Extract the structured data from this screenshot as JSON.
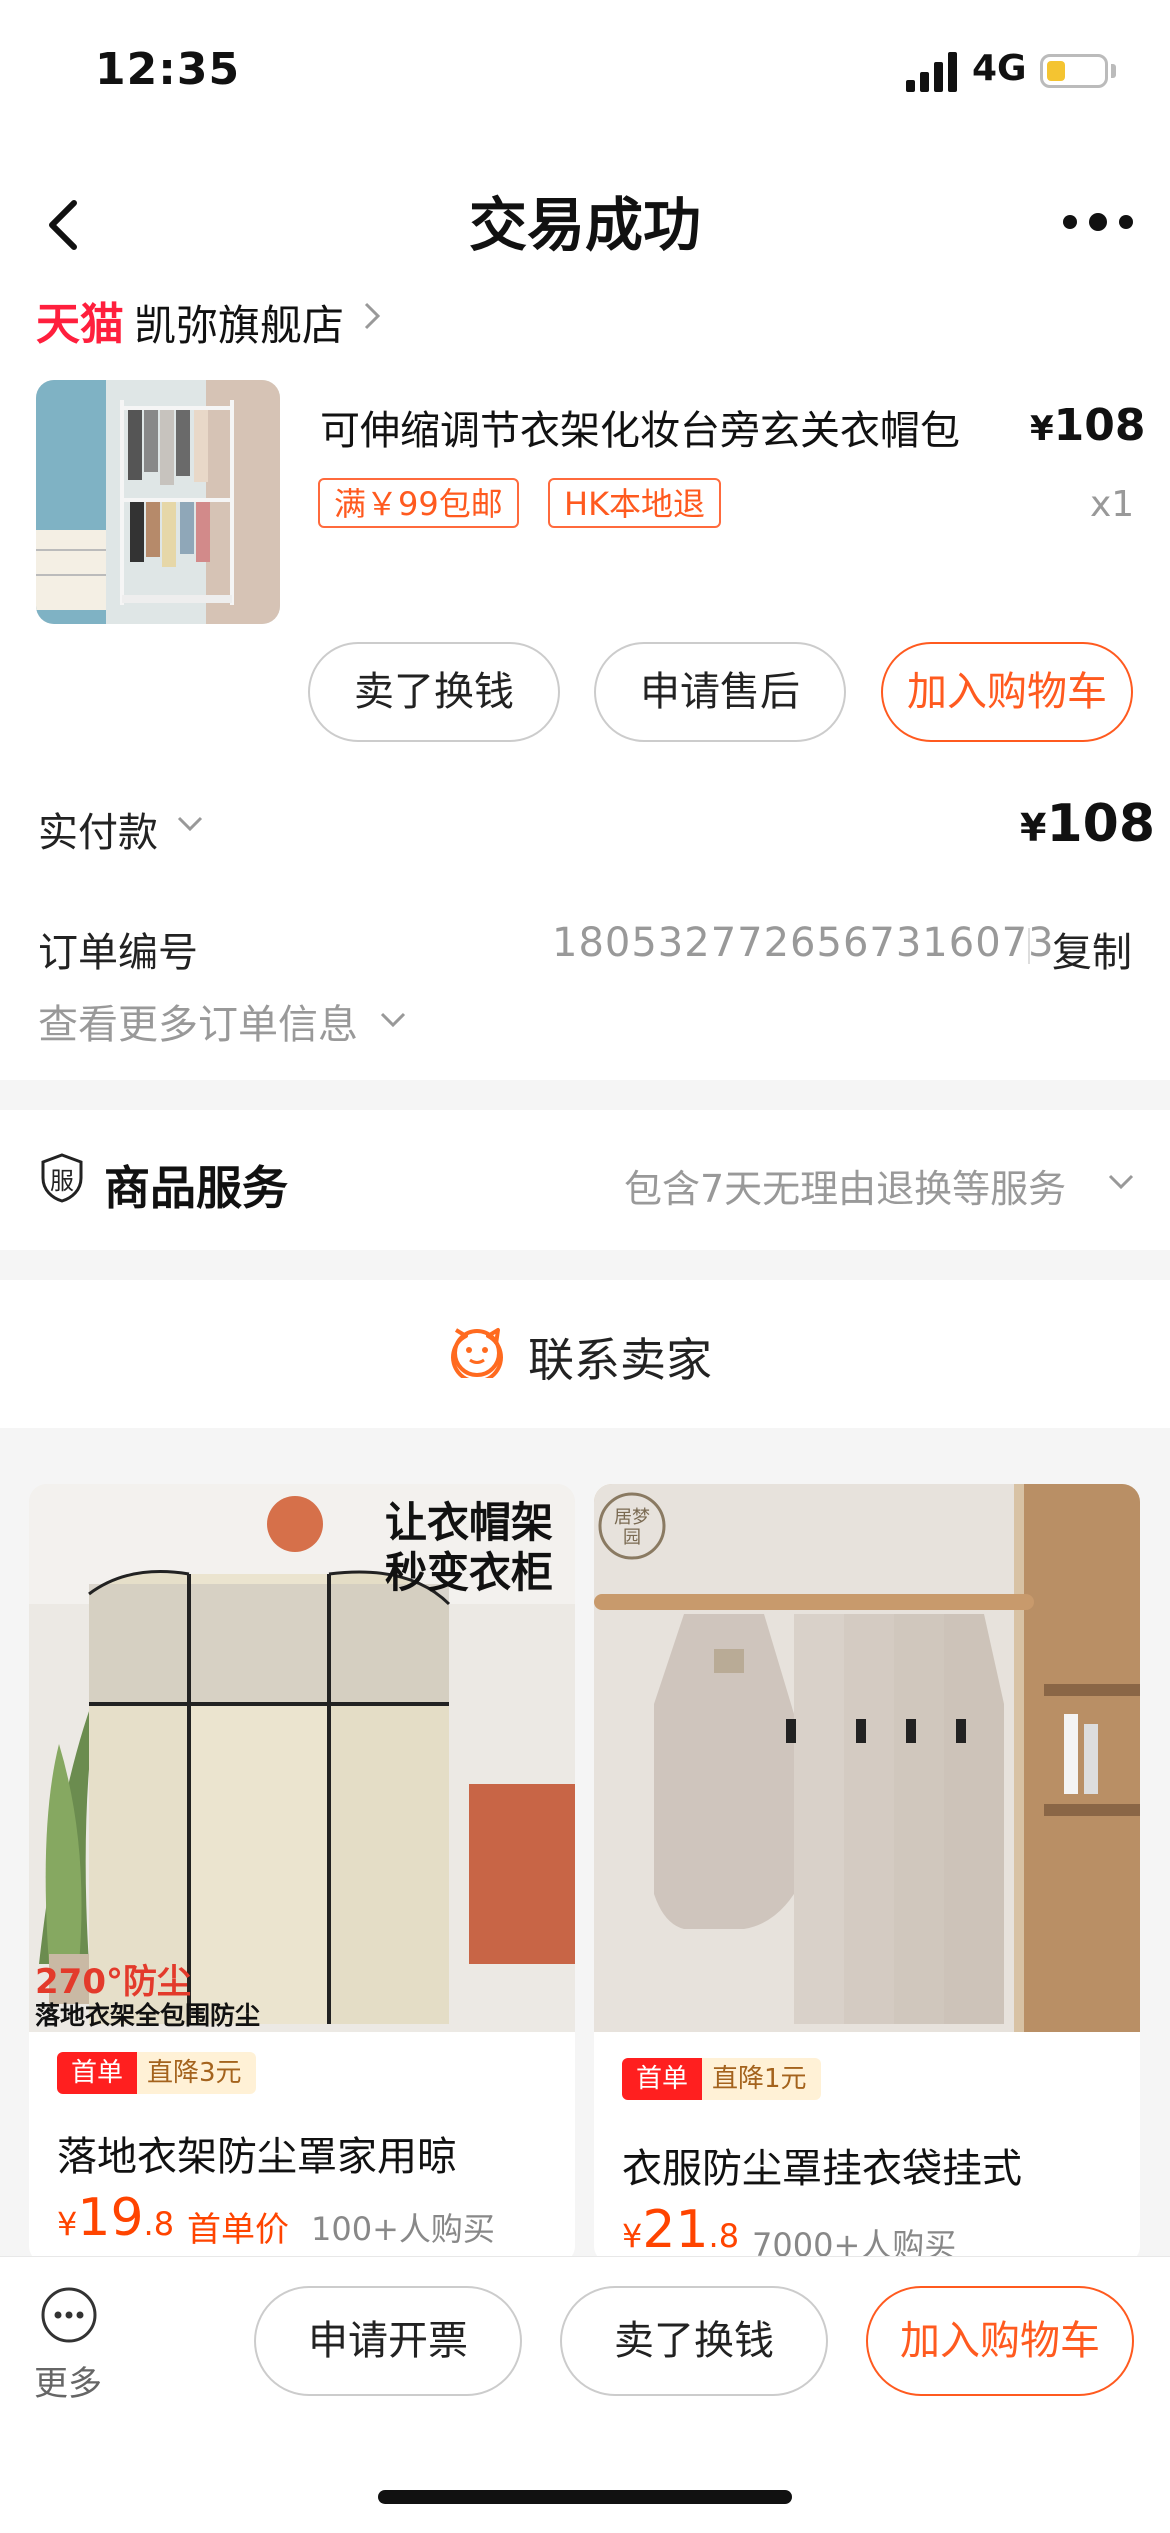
{
  "status_bar": {
    "time": "12:35",
    "network": "4G"
  },
  "nav": {
    "title": "交易成功"
  },
  "store": {
    "platform": "天猫",
    "name": "凯弥旗舰店"
  },
  "product": {
    "title": "可伸缩调节衣架化妆台旁玄关衣帽包",
    "price_symbol": "¥",
    "price": "108",
    "tags": [
      "满￥99包邮",
      "HK本地退"
    ],
    "quantity": "x1"
  },
  "actions": {
    "sell": "卖了换钱",
    "after_sale": "申请售后",
    "add_cart": "加入购物车"
  },
  "payment": {
    "label": "实付款",
    "symbol": "¥",
    "amount": "108"
  },
  "order": {
    "label": "订单编号",
    "number": "1805327726567316073",
    "copy": "复制",
    "more": "查看更多订单信息"
  },
  "service": {
    "icon_text": "服",
    "title": "商品服务",
    "desc": "包含7天无理由退换等服务"
  },
  "contact": {
    "label": "联系卖家"
  },
  "recommendations": [
    {
      "image_text_1": "让衣帽架",
      "image_text_2": "秒变衣柜",
      "image_text_3": "270°防尘",
      "image_text_4": "落地衣架全包围防尘",
      "badge_first": "首单",
      "badge_discount": "直降3元",
      "title": "落地衣架防尘罩家用晾",
      "price_symbol": "¥",
      "price_int": "19",
      "price_dec": ".8",
      "first_price_label": "首单价",
      "sold": "100+人购买"
    },
    {
      "image_logo": "居梦园",
      "badge_first": "首单",
      "badge_discount": "直降1元",
      "title": "衣服防尘罩挂衣袋挂式",
      "price_symbol": "¥",
      "price_int": "21",
      "price_dec": ".8",
      "sold": "7000+人购买"
    }
  ],
  "bottom_bar": {
    "more": "更多",
    "invoice": "申请开票",
    "sell": "卖了换钱",
    "add_cart": "加入购物车"
  },
  "colors": {
    "accent": "#ff5a1f",
    "tmall_red": "#ff1f3d",
    "price_orange": "#ff4400"
  }
}
